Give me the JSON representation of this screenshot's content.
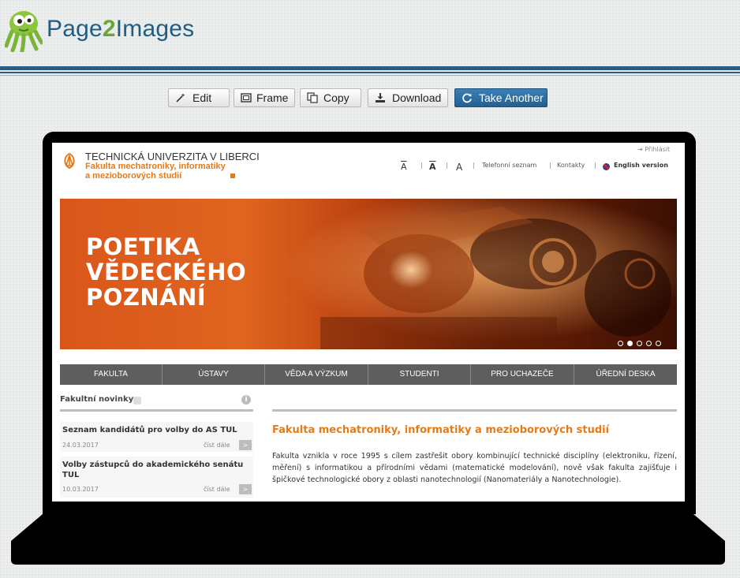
{
  "app": {
    "brand_pre": "Page",
    "brand_num": "2",
    "brand_post": "Images"
  },
  "toolbar": {
    "edit_label": "Edit",
    "frame_label": "Frame",
    "copy_label": "Copy",
    "download_label": "Download",
    "take_another_label": "Take Another"
  },
  "colors": {
    "brand_blue": "#1f5d84",
    "brand_green": "#6aa63a",
    "primary_button": "#2a6aa0",
    "site_orange": "#e47b1a",
    "site_nav": "#5e5e5e"
  },
  "site": {
    "university": "TECHNICKÁ UNIVERZITA V LIBERCI",
    "faculty_line1": "Fakulta mechatroniky, informatiky",
    "faculty_line2": "a mezioborových studií",
    "login": "Přihlásit",
    "util": {
      "font_small": "A",
      "font_reset": "A",
      "font_large": "A",
      "sep": "|",
      "phone": "Telefonní seznam",
      "contacts": "Kontakty",
      "english": "English version"
    },
    "banner": {
      "line1": "POETIKA",
      "line2": "VĚDECKÉHO",
      "line3": "POZNÁNÍ",
      "slides": 5,
      "active_slide": 2
    },
    "nav": [
      "FAKULTA",
      "ÚSTAVY",
      "VĚDA A VÝZKUM",
      "STUDENTI",
      "PRO UCHAZEČE",
      "ÚŘEDNÍ DESKA"
    ],
    "news": {
      "heading": "Fakultní novinky",
      "info": "i",
      "items": [
        {
          "title": "Seznam kandidátů pro volby do AS TUL",
          "date": "24.03.2017",
          "more": "číst dále",
          "go": ">"
        },
        {
          "title": "Volby zástupců do akademického senátu TUL",
          "date": "10.03.2017",
          "more": "číst dále",
          "go": ">"
        }
      ]
    },
    "main": {
      "heading": "Fakulta mechatroniky, informatiky a mezioborových studií",
      "paragraph": "Fakulta vznikla v roce 1995 s cílem zastřešit obory kombinující technické disciplíny (elektroniku, řízení, měření) s informatikou a přírodními vědami (matematické modelování), nově však fakulta zajišťuje i špičkové technologické obory z oblasti nanotechnologií (Nanomateriály a Nanotechnologie)."
    }
  }
}
